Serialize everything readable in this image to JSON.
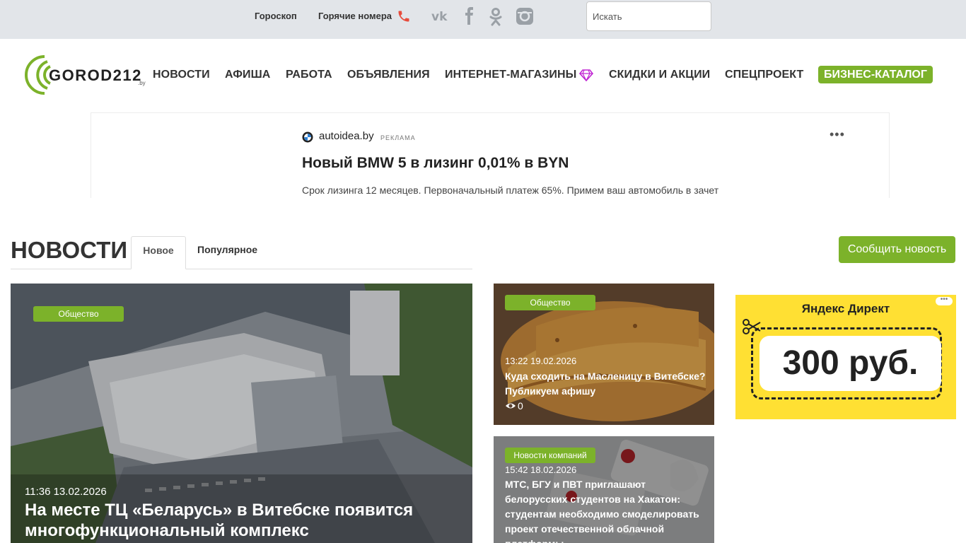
{
  "topbar": {
    "horoscope": "Гороскоп",
    "hotlines": "Горячие номера",
    "search_placeholder": "Искать"
  },
  "logo": {
    "text": "GOROD212",
    "suffix": ".by"
  },
  "nav": {
    "items": [
      "НОВОСТИ",
      "АФИША",
      "РАБОТА",
      "ОБЪЯВЛЕНИЯ",
      "ИНТЕРНЕТ-МАГАЗИНЫ",
      "СКИДКИ И АКЦИИ",
      "СПЕЦПРОЕКТ"
    ],
    "business_catalog": "БИЗНЕС-КАТАЛОГ"
  },
  "ad": {
    "domain": "autoidea.by",
    "tag": "РЕКЛАМА",
    "more": "•••",
    "title": "Новый BMW 5 в лизинг 0,01% в BYN",
    "text": "Срок лизинга 12 месяцев. Первоначальный платеж 65%. Примем ваш автомобиль в зачет"
  },
  "news": {
    "title": "НОВОСТИ",
    "tab_new": "Новое",
    "tab_popular": "Популярное",
    "report_button": "Сообщить новость"
  },
  "main_article": {
    "category": "Общество",
    "time": "11:36 13.02.2026",
    "headline": "На месте ТЦ «Беларусь» в Витебске появится многофункциональный комплекс"
  },
  "side_articles": [
    {
      "category": "Общество",
      "time": "13:22 19.02.2026",
      "headline": "Куда сходить на Масленицу в Витебске? Публикуем афишу",
      "views": "0"
    },
    {
      "category": "Новости компаний",
      "time": "15:42 18.02.2026",
      "headline": "МТС, БГУ и ПВТ приглашают белорусских студентов на Хакатон: студентам необходимо смоделировать проект отечественной облачной платформы"
    }
  ],
  "yandex_ad": {
    "brand": "Яндекс Директ",
    "price": "300 руб."
  },
  "colors": {
    "brand_green": "#7cb22a",
    "topbar_bg": "#e2e5e9",
    "ad_yellow": "#ffe033"
  }
}
